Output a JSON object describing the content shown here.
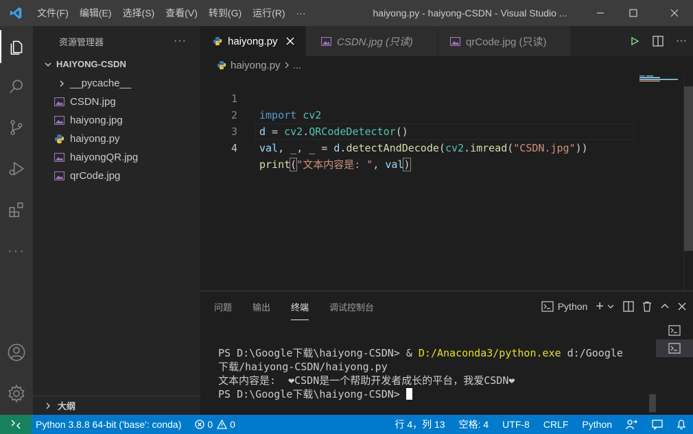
{
  "titlebar": {
    "menu": [
      "文件(F)",
      "编辑(E)",
      "选择(S)",
      "查看(V)",
      "转到(G)",
      "运行(R)",
      "···"
    ],
    "title": "haiyong.py - haiyong-CSDN - Visual Studio ..."
  },
  "sidebar": {
    "header": "资源管理器",
    "more": "···",
    "section": "HAIYONG-CSDN",
    "folder": "__pycache__",
    "files": [
      {
        "name": "CSDN.jpg",
        "icon": "image-file-icon"
      },
      {
        "name": "haiyong.jpg",
        "icon": "image-file-icon"
      },
      {
        "name": "haiyong.py",
        "icon": "python-file-icon"
      },
      {
        "name": "haiyongQR.jpg",
        "icon": "image-file-icon"
      },
      {
        "name": "qrCode.jpg",
        "icon": "image-file-icon"
      }
    ],
    "outline": "大纲"
  },
  "tabs": [
    {
      "label": "haiyong.py",
      "active": true
    },
    {
      "label": "CSDN.jpg (只读)",
      "active": false
    },
    {
      "label": "qrCode.jpg (只读)",
      "active": false
    }
  ],
  "breadcrumb": {
    "file": "haiyong.py",
    "rest": "..."
  },
  "editor": {
    "line_numbers": [
      "1",
      "2",
      "3",
      "4"
    ],
    "l1": {
      "a": "import",
      "b": " cv2"
    },
    "l2": {
      "a": "d",
      "b": " = ",
      "c": "cv2",
      "d": ".",
      "e": "QRCodeDetector",
      "f": "()"
    },
    "l3": {
      "a": "val",
      "b": ", ",
      "c": "_",
      "d": ", ",
      "e": "_",
      "f": " = ",
      "g": "d",
      "h": ".",
      "i": "detectAndDecode",
      "j": "(",
      "k": "cv2",
      "l": ".",
      "m": "imread",
      "n": "(",
      "o": "\"CSDN.jpg\"",
      "p": "))"
    },
    "l4": {
      "a": "print",
      "b": "(",
      "c": "\"文本内容是: \"",
      "d": ", ",
      "e": "val",
      "f": ")"
    }
  },
  "panel": {
    "tabs": [
      "问题",
      "输出",
      "终端",
      "调试控制台"
    ],
    "active_tab": "终端",
    "shell": "Python",
    "plus": "+",
    "terminal": {
      "l1a": "PS D:\\Google下载\\haiyong-CSDN> & ",
      "l1b": "D:/Anaconda3/python.exe",
      "l1c": " d:/Google",
      "l2": "下载/haiyong-CSDN/haiyong.py",
      "l3": "文本内容是:  ❤CSDN是一个帮助开发者成长的平台，我爱CSDN❤",
      "l4": "PS D:\\Google下载\\haiyong-CSDN> "
    }
  },
  "statusbar": {
    "interpreter": "Python 3.8.8 64-bit ('base': conda)",
    "errors": "0",
    "warnings": "0",
    "position": "行 4，列 13",
    "spaces": "空格: 4",
    "encoding": "UTF-8",
    "eol": "CRLF",
    "language": "Python"
  },
  "colors": {
    "accent": "#007acc",
    "remote": "#16825d",
    "title_bg": "#3c3c3c"
  }
}
